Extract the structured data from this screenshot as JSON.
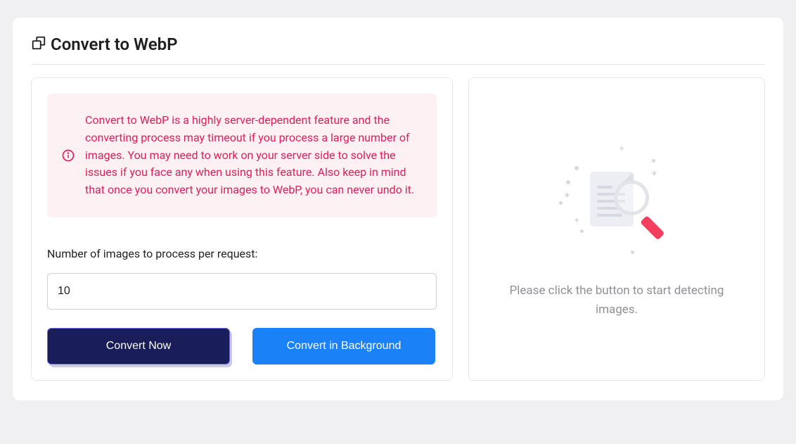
{
  "page": {
    "title": "Convert to WebP"
  },
  "alert": {
    "text": "Convert to WebP is a highly server-dependent feature and the converting process may timeout if you process a large number of images. You may need to work on your server side to solve the issues if you face any when using this feature. Also keep in mind that once you convert your images to WebP, you can never undo it."
  },
  "form": {
    "label": "Number of images to process per request:",
    "value": "10"
  },
  "buttons": {
    "convert_now": "Convert Now",
    "convert_bg": "Convert in Background"
  },
  "right_panel": {
    "message": "Please click the button to start detecting images."
  }
}
